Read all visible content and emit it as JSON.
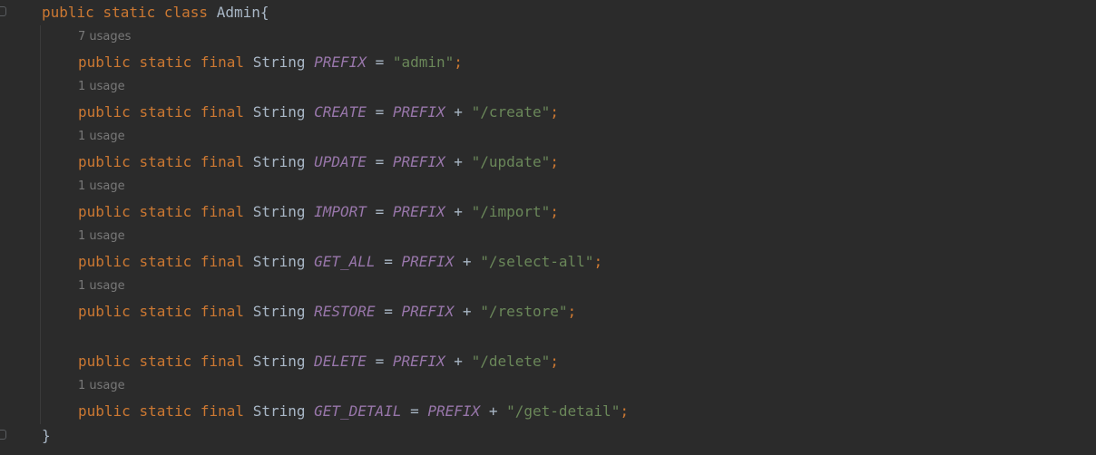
{
  "class_decl": {
    "kw_public": "public",
    "kw_static": "static",
    "kw_class": "class",
    "name": "Admin",
    "open": "{"
  },
  "close_brace": "}",
  "fields": [
    {
      "usage": "7 usages",
      "kw1": "public",
      "kw2": "static",
      "kw3": "final",
      "type": "String",
      "name": "PREFIX",
      "eq": "=",
      "ref": "",
      "plus": "",
      "value": "\"admin\"",
      "semi": ";"
    },
    {
      "usage": "1 usage",
      "kw1": "public",
      "kw2": "static",
      "kw3": "final",
      "type": "String",
      "name": "CREATE",
      "eq": "=",
      "ref": "PREFIX",
      "plus": "+",
      "value": "\"/create\"",
      "semi": ";"
    },
    {
      "usage": "1 usage",
      "kw1": "public",
      "kw2": "static",
      "kw3": "final",
      "type": "String",
      "name": "UPDATE",
      "eq": "=",
      "ref": "PREFIX",
      "plus": "+",
      "value": "\"/update\"",
      "semi": ";"
    },
    {
      "usage": "1 usage",
      "kw1": "public",
      "kw2": "static",
      "kw3": "final",
      "type": "String",
      "name": "IMPORT",
      "eq": "=",
      "ref": "PREFIX",
      "plus": "+",
      "value": "\"/import\"",
      "semi": ";"
    },
    {
      "usage": "1 usage",
      "kw1": "public",
      "kw2": "static",
      "kw3": "final",
      "type": "String",
      "name": "GET_ALL",
      "eq": "=",
      "ref": "PREFIX",
      "plus": "+",
      "value": "\"/select-all\"",
      "semi": ";"
    },
    {
      "usage": "1 usage",
      "kw1": "public",
      "kw2": "static",
      "kw3": "final",
      "type": "String",
      "name": "RESTORE",
      "eq": "=",
      "ref": "PREFIX",
      "plus": "+",
      "value": "\"/restore\"",
      "semi": ";"
    },
    {
      "usage": "",
      "kw1": "public",
      "kw2": "static",
      "kw3": "final",
      "type": "String",
      "name": "DELETE",
      "eq": "=",
      "ref": "PREFIX",
      "plus": "+",
      "value": "\"/delete\"",
      "semi": ";"
    },
    {
      "usage": "1 usage",
      "kw1": "public",
      "kw2": "static",
      "kw3": "final",
      "type": "String",
      "name": "GET_DETAIL",
      "eq": "=",
      "ref": "PREFIX",
      "plus": "+",
      "value": "\"/get-detail\"",
      "semi": ";"
    }
  ],
  "colors": {
    "background": "#2b2b2b",
    "keyword": "#cc7832",
    "constant": "#9876aa",
    "string": "#6a8759",
    "text": "#a9b7c6",
    "hint": "#787878"
  }
}
